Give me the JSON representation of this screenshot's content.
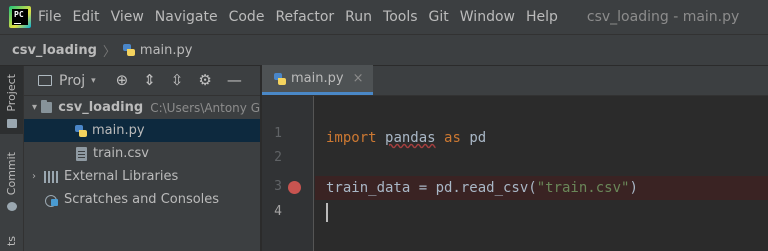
{
  "menubar": {
    "logo_text": "PC",
    "items": [
      "File",
      "Edit",
      "View",
      "Navigate",
      "Code",
      "Refactor",
      "Run",
      "Tools",
      "Git",
      "Window",
      "Help"
    ],
    "window_title": "csv_loading - main.py"
  },
  "navbar": {
    "project": "csv_loading",
    "file": "main.py"
  },
  "toolstrip": {
    "tabs": [
      "Project",
      "Commit",
      "ts"
    ]
  },
  "project_panel": {
    "title": "Proj",
    "tree": {
      "root": {
        "label": "csv_loading",
        "path": "C:\\Users\\Antony G"
      },
      "files": [
        "main.py",
        "train.csv"
      ],
      "external_libraries": "External Libraries",
      "scratches": "Scratches and Consoles"
    }
  },
  "editor": {
    "tab_label": "main.py",
    "tab_close": "×",
    "line_numbers": [
      "1",
      "2",
      "3",
      "4"
    ],
    "code": {
      "line1": {
        "kw1": "import",
        "mod": "pandas",
        "kw2": "as",
        "alias": "pd"
      },
      "line3": {
        "lhs": "train_data = pd.read_csv(",
        "str": "\"train.csv\"",
        "rhs": ")"
      }
    }
  },
  "colors": {
    "keyword": "#cc7832",
    "string": "#6a8759",
    "breakpoint": "#c75450",
    "selection": "#0d293e"
  }
}
